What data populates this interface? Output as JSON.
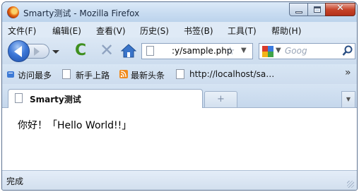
{
  "window": {
    "title": "Smarty测试 - Mozilla Firefox"
  },
  "menu": {
    "items": [
      "文件(F)",
      "编辑(E)",
      "查看(V)",
      "历史(S)",
      "书签(B)",
      "工具(T)",
      "帮助(H)"
    ]
  },
  "nav": {
    "url": ":y/sample.php",
    "search_placeholder": "Goog"
  },
  "bookmarks": {
    "items": [
      "访问最多",
      "新手上路",
      "最新头条",
      "http://localhost/sa…"
    ],
    "more": "»"
  },
  "tabs": {
    "active_label": "Smarty测试",
    "new_tab": "+"
  },
  "page": {
    "content": "你好！「Hello World!!」"
  },
  "status": {
    "text": "完成"
  },
  "colors": {
    "titlebar": "#c8dcf1",
    "close_button": "#c7442a",
    "reload_green": "#3f8f1f"
  },
  "icons": [
    "firefox-logo-icon",
    "minimize-icon",
    "maximize-icon",
    "close-icon",
    "back-arrow-icon",
    "forward-arrow-icon",
    "history-dropdown-icon",
    "reload-icon",
    "stop-icon",
    "home-icon",
    "page-icon",
    "bookmark-star-icon",
    "search-engine-icon",
    "search-icon",
    "rss-feed-icon",
    "chevron-right-icon",
    "resize-grip-icon"
  ]
}
